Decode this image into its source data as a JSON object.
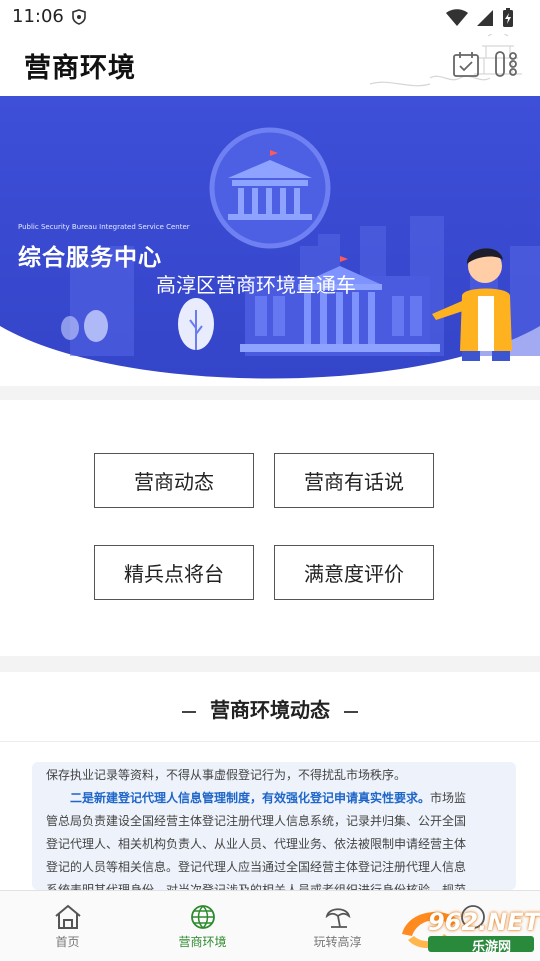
{
  "status": {
    "time": "11:06"
  },
  "app": {
    "title": "营商环境"
  },
  "banner": {
    "small_en": "Public Security Bureau Integrated Service Center",
    "heading": "综合服务中心",
    "subheading": "高淳区营商环境直通车",
    "colors": {
      "primary": "#3f50d9",
      "dark": "#2b3ab8"
    }
  },
  "grid": {
    "buttons": [
      {
        "label": "营商动态"
      },
      {
        "label": "营商有话说"
      },
      {
        "label": "精兵点将台"
      },
      {
        "label": "满意度评价"
      }
    ]
  },
  "news": {
    "section_title": "营商环境动态",
    "para1": "保存执业记录等资料，不得从事虚假登记行为，不得扰乱市场秩序。",
    "para2_highlight": "二是新建登记代理人信息管理制度，有效强化登记申请真实性要求。",
    "para2_rest_1": "市场监",
    "line3": "管总局负责建设全国经营主体登记注册代理人信息系统，记录并归集、公开全国",
    "line4": "登记代理人、相关机构负责人、从业人员、代理业务、依法被限制申请经营主体",
    "line5": "登记的人员等相关信息。登记代理人应当通过全国经营主体登记注册代理人信息",
    "line6": "系统表明其代理身份，对当次登记涉及的相关人员或者组织进行身份核验，规范"
  },
  "tabs": [
    {
      "label": "首页",
      "icon": "home-icon"
    },
    {
      "label": "营商环境",
      "icon": "globe-icon",
      "active": true
    },
    {
      "label": "玩转高淳",
      "icon": "umbrella-icon"
    }
  ],
  "watermark": {
    "brand": "962.NET",
    "sub": "乐游网"
  },
  "colors": {
    "accent_green": "#2d8a2d"
  }
}
